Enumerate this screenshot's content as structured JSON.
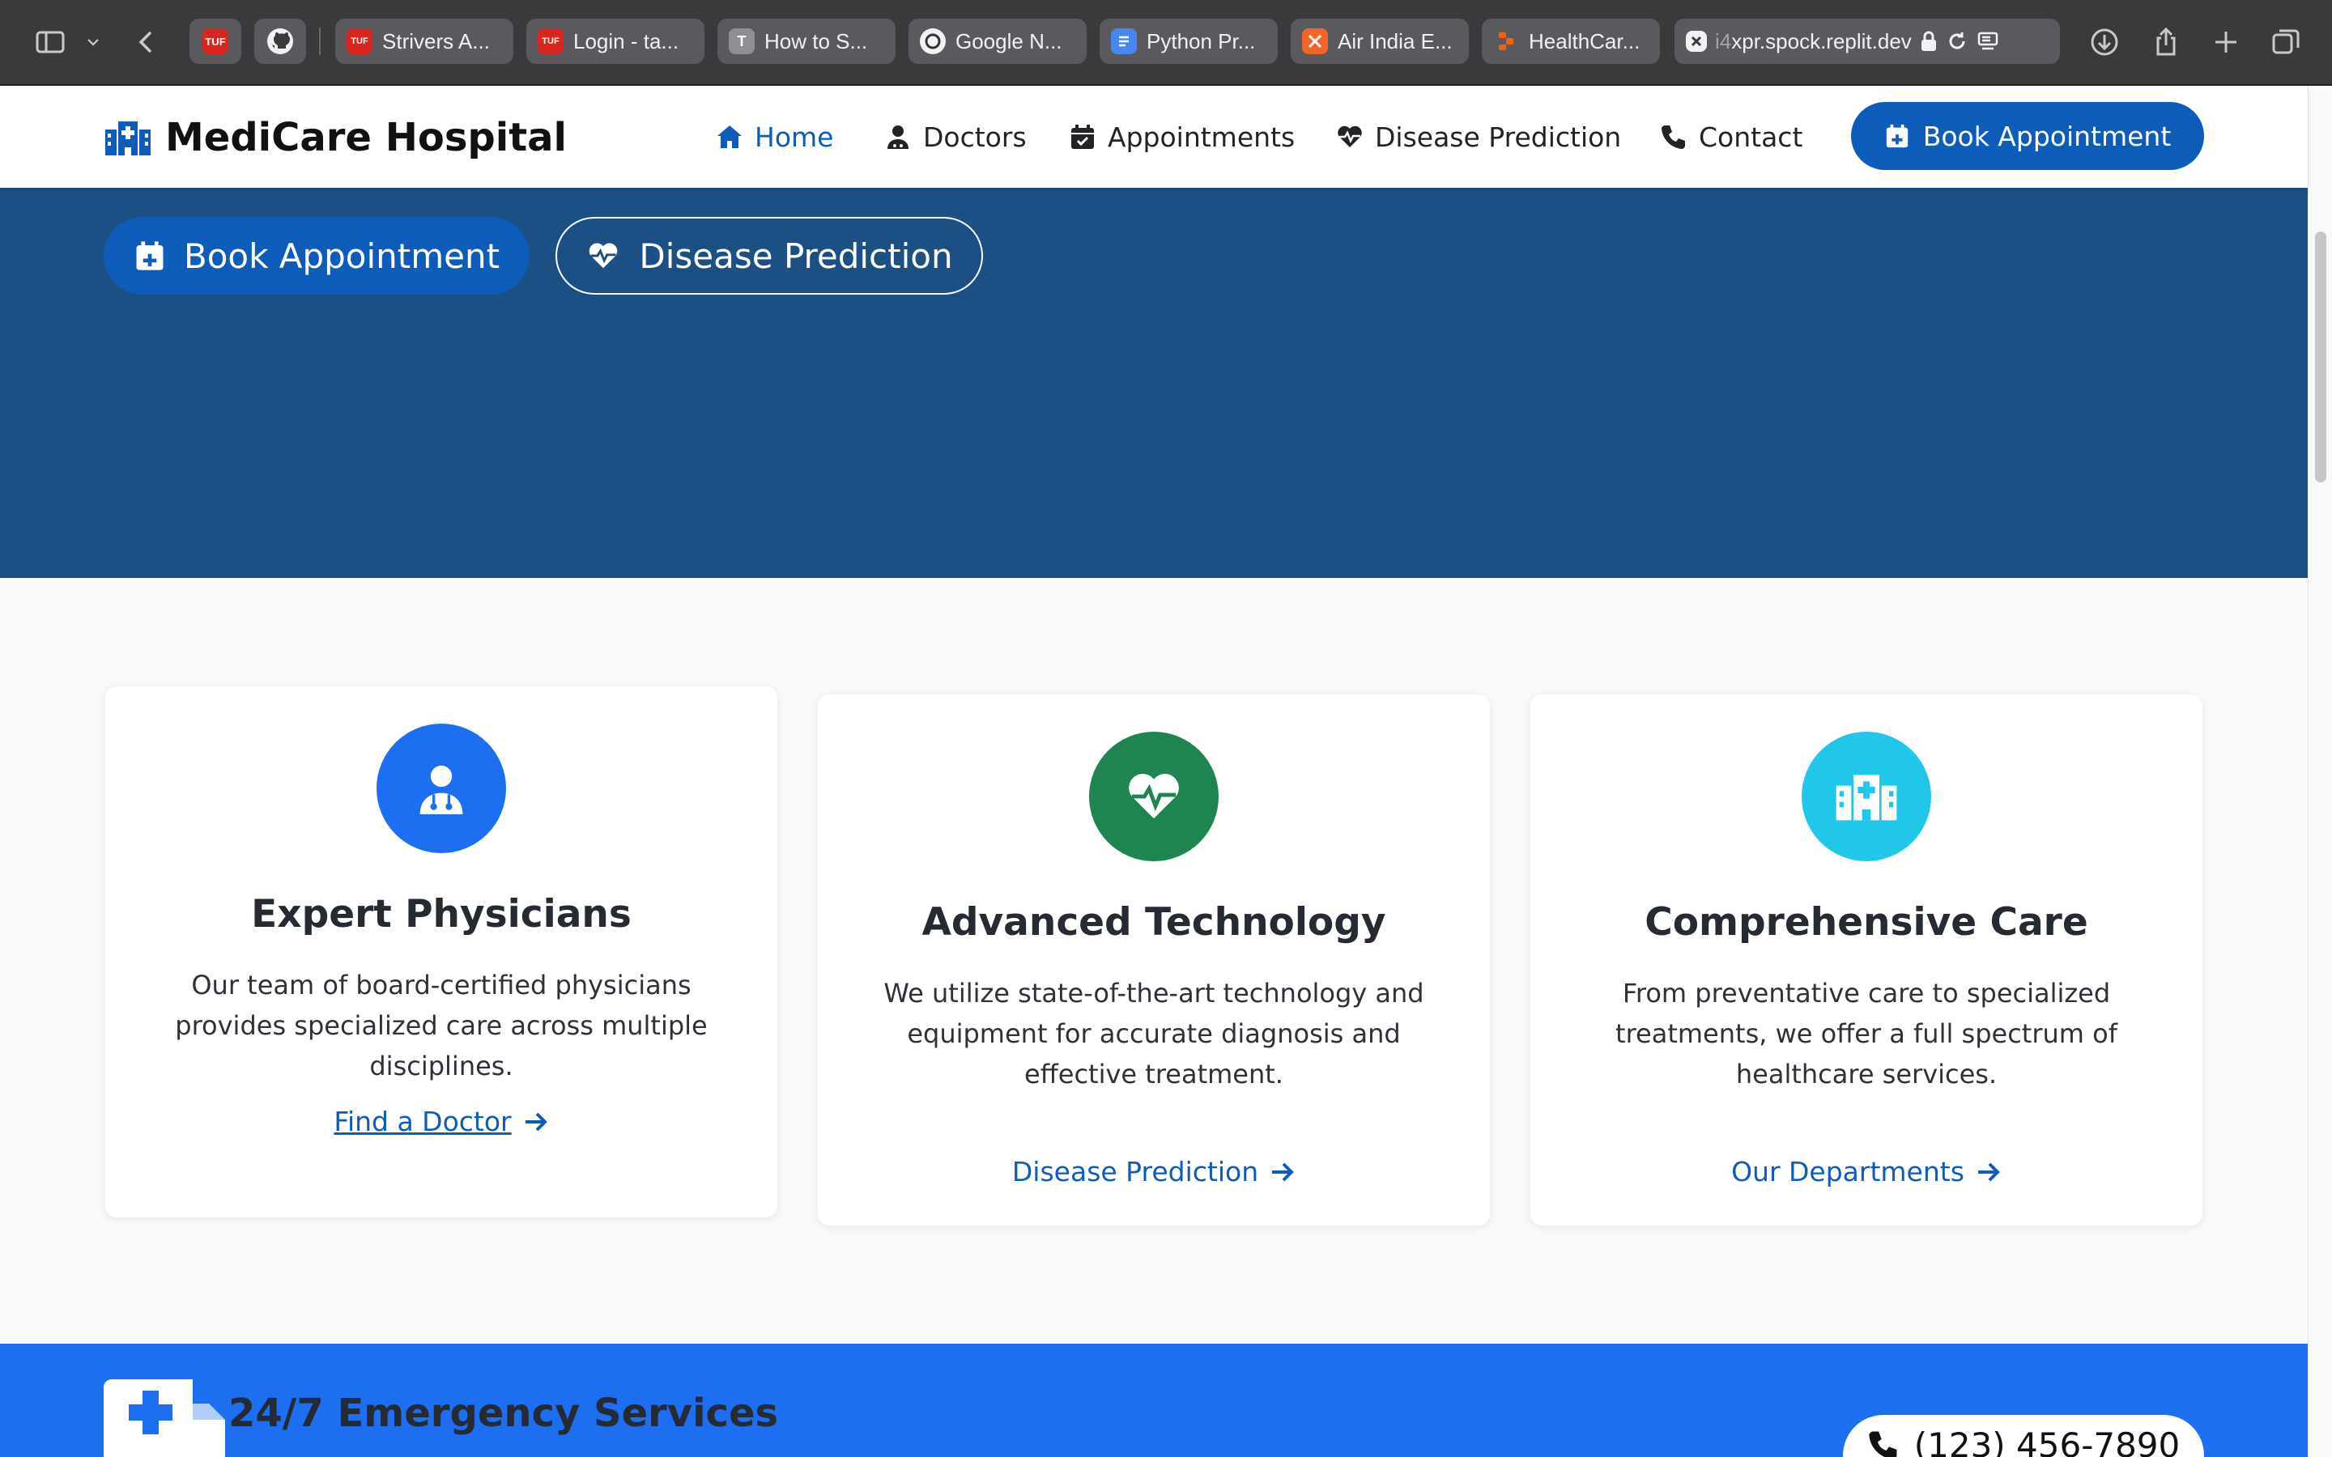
{
  "browser": {
    "tabs": [
      {
        "label": "Strivers A...",
        "favicon": "tuf-logo"
      },
      {
        "label": "Login - ta...",
        "favicon": "tuf-logo"
      },
      {
        "label": "How to S...",
        "favicon": "t-letter"
      },
      {
        "label": "Google N...",
        "favicon": "google-notebook"
      },
      {
        "label": "Python Pr...",
        "favicon": "google-docs"
      },
      {
        "label": "Air India E...",
        "favicon": "x-orange"
      },
      {
        "label": "HealthCar...",
        "favicon": "replit"
      }
    ],
    "pinned_tab_text": "TUF",
    "address_prefix": "i4",
    "address": "xpr.spock.replit.dev"
  },
  "navbar": {
    "brand": "MediCare Hospital",
    "links": [
      {
        "label": "Home",
        "icon": "home-icon",
        "active": true
      },
      {
        "label": "Doctors",
        "icon": "doctor-icon"
      },
      {
        "label": "Appointments",
        "icon": "calendar-check-icon"
      },
      {
        "label": "Disease Prediction",
        "icon": "heart-pulse-icon"
      },
      {
        "label": "Contact",
        "icon": "phone-icon"
      }
    ],
    "cta": "Book Appointment"
  },
  "hero": {
    "primary_button": "Book Appointment",
    "secondary_button": "Disease Prediction"
  },
  "features": [
    {
      "title": "Expert Physicians",
      "description": "Our team of board-certified physicians provides specialized care across multiple disciplines.",
      "link": "Find a Doctor",
      "icon": "doctor-icon",
      "color": "#1d6ef1"
    },
    {
      "title": "Advanced Technology",
      "description": "We utilize state-of-the-art technology and equipment for accurate diagnosis and effective treatment.",
      "link": "Disease Prediction",
      "icon": "heart-pulse-icon",
      "color": "#1e8450"
    },
    {
      "title": "Comprehensive Care",
      "description": "From preventative care to specialized treatments, we offer a full spectrum of healthcare services.",
      "link": "Our Departments",
      "icon": "hospital-icon",
      "color": "#20c7e9"
    }
  ],
  "emergency": {
    "title": "24/7 Emergency Services",
    "phone": "(123) 456-7890"
  },
  "colors": {
    "primary": "#0d5cba",
    "hero_bg": "#1c4f84",
    "emergency_bg": "#1d6ef1"
  }
}
